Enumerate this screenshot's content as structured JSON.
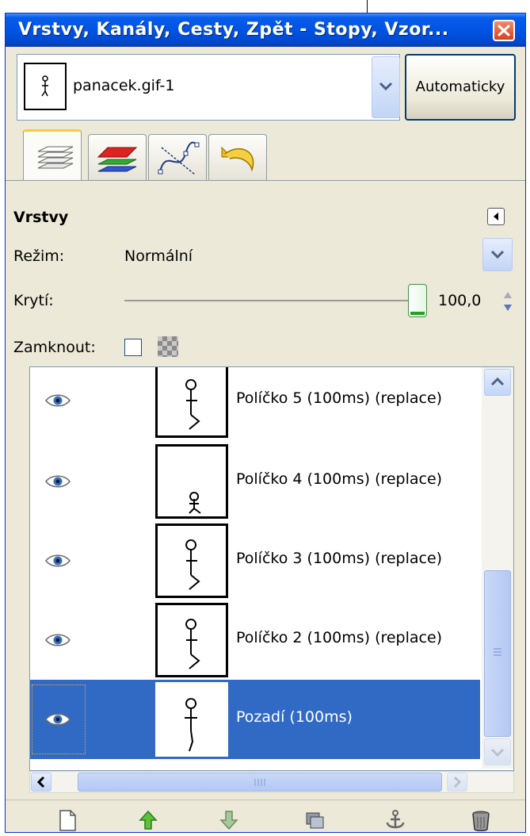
{
  "window": {
    "title": "Vrstvy, Kanály, Cesty, Zpět - Stopy, Vzor...",
    "close_icon": "close-icon"
  },
  "image_selector": {
    "value": "panacek.gif-1",
    "auto_button_label": "Automaticky"
  },
  "tabs": [
    {
      "name": "layers",
      "icon": "layers-tab-icon",
      "active": true
    },
    {
      "name": "channels",
      "icon": "channels-tab-icon",
      "active": false
    },
    {
      "name": "paths",
      "icon": "paths-tab-icon",
      "active": false
    },
    {
      "name": "undo-history",
      "icon": "undo-tab-icon",
      "active": false
    }
  ],
  "panel": {
    "title": "Vrstvy",
    "mode_label": "Režim:",
    "mode_value": "Normální",
    "opacity_label": "Krytí:",
    "opacity_value": "100,0",
    "opacity_fraction": 1.0,
    "lock_label": "Zamknout:"
  },
  "layers": [
    {
      "name": "Políčko 5 (100ms) (replace)",
      "visible": true,
      "selected": false
    },
    {
      "name": "Políčko 4 (100ms) (replace)",
      "visible": true,
      "selected": false
    },
    {
      "name": "Políčko 3 (100ms) (replace)",
      "visible": true,
      "selected": false
    },
    {
      "name": "Políčko 2 (100ms) (replace)",
      "visible": true,
      "selected": false
    },
    {
      "name": "Pozadí (100ms)",
      "visible": true,
      "selected": true
    }
  ],
  "toolbar": {
    "buttons": [
      "new-layer-icon",
      "raise-layer-icon",
      "lower-layer-icon",
      "duplicate-layer-icon",
      "anchor-layer-icon",
      "delete-layer-icon"
    ]
  },
  "colors": {
    "titlebar": "#0054e3",
    "selection": "#316ac5",
    "panel_bg": "#ece9d8"
  }
}
